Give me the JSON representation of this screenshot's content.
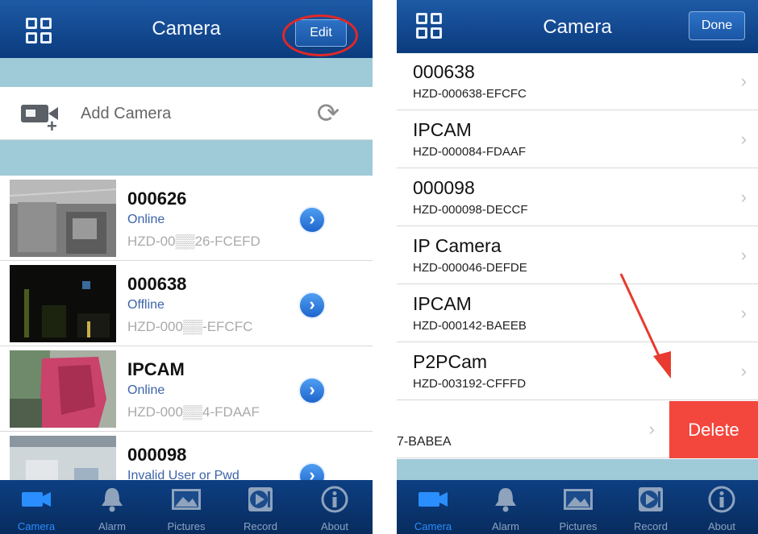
{
  "left_screen": {
    "header": {
      "title": "Camera",
      "edit_label": "Edit"
    },
    "add_camera": {
      "label": "Add Camera"
    },
    "cameras": [
      {
        "name": "000626",
        "status": "Online",
        "uid": "HZD-00▒▒26-FCEFD"
      },
      {
        "name": "000638",
        "status": "Offline",
        "uid": "HZD-000▒▒-EFCFC"
      },
      {
        "name": "IPCAM",
        "status": "Online",
        "uid": "HZD-000▒▒4-FDAAF"
      },
      {
        "name": "000098",
        "status": "Invalid User or Pwd",
        "uid": ""
      }
    ]
  },
  "right_screen": {
    "header": {
      "title": "Camera",
      "done_label": "Done"
    },
    "cameras": [
      {
        "name": "000638",
        "uid": "HZD-000638-EFCFC"
      },
      {
        "name": "IPCAM",
        "uid": "HZD-000084-FDAAF"
      },
      {
        "name": "000098",
        "uid": "HZD-000098-DECCF"
      },
      {
        "name": "IP Camera",
        "uid": "HZD-000046-DEFDE"
      },
      {
        "name": "IPCAM",
        "uid": "HZD-000142-BAEEB"
      },
      {
        "name": "P2PCam",
        "uid": "HZD-003192-CFFFD"
      }
    ],
    "swiped_row": {
      "uid_fragment": "7-BABEA",
      "delete_label": "Delete"
    }
  },
  "tabbar": {
    "tabs": [
      {
        "label": "Camera",
        "icon": "video-camera-icon",
        "active": true
      },
      {
        "label": "Alarm",
        "icon": "bell-icon",
        "active": false
      },
      {
        "label": "Pictures",
        "icon": "picture-icon",
        "active": false
      },
      {
        "label": "Record",
        "icon": "record-icon",
        "active": false
      },
      {
        "label": "About",
        "icon": "info-icon",
        "active": false
      }
    ]
  },
  "colors": {
    "header_blue": "#0b3b7d",
    "section_band": "#9fcad8",
    "active_tab": "#2a8eff",
    "delete_red": "#f3463d",
    "annotation_red": "#e02828"
  }
}
